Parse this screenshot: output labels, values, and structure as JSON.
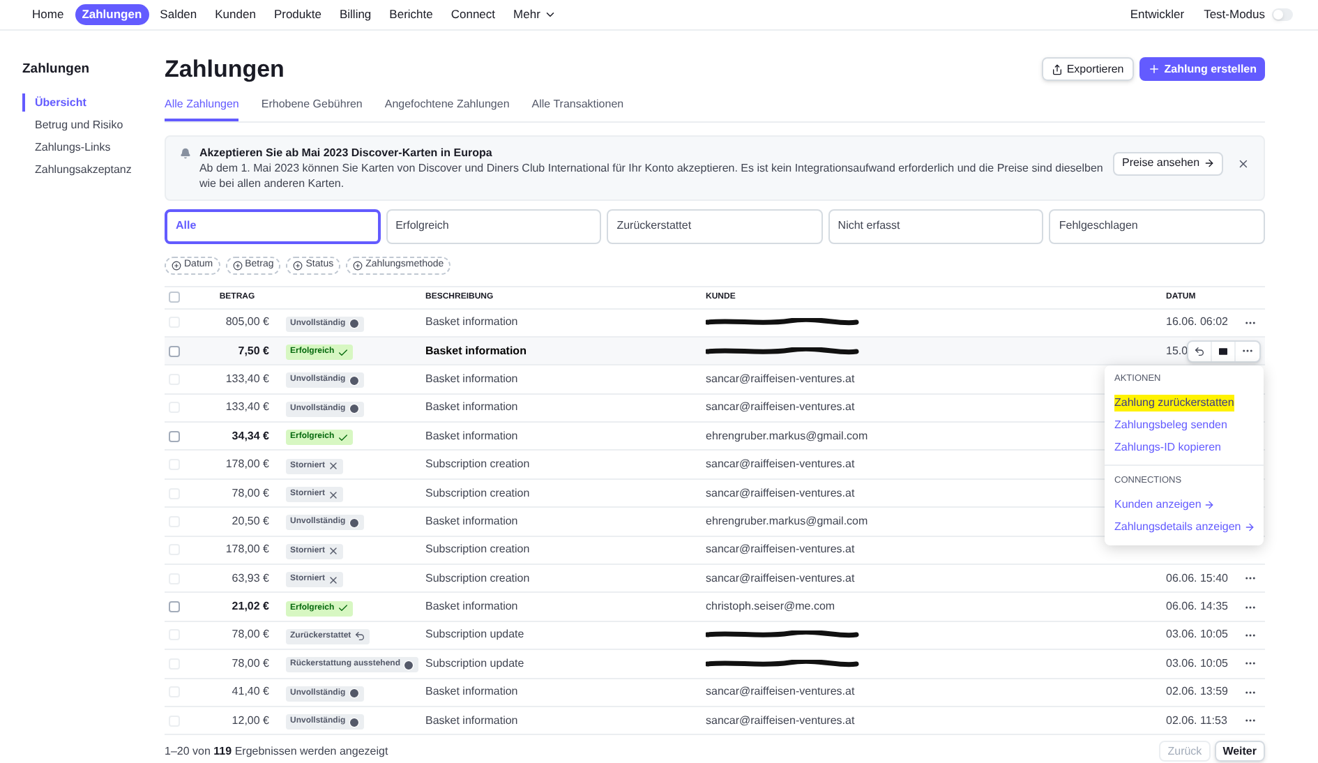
{
  "nav": {
    "items": [
      {
        "label": "Home",
        "selected": false
      },
      {
        "label": "Zahlungen",
        "selected": true
      },
      {
        "label": "Salden",
        "selected": false
      },
      {
        "label": "Kunden",
        "selected": false
      },
      {
        "label": "Produkte",
        "selected": false
      },
      {
        "label": "Billing",
        "selected": false
      },
      {
        "label": "Berichte",
        "selected": false
      },
      {
        "label": "Connect",
        "selected": false
      },
      {
        "label": "Mehr",
        "selected": false
      }
    ],
    "developer": "Entwickler",
    "test_mode": {
      "label": "Test-Modus",
      "on": false
    }
  },
  "sidebar": {
    "title": "Zahlungen",
    "items": [
      {
        "label": "Übersicht",
        "selected": true
      },
      {
        "label": "Betrug und Risiko",
        "selected": false
      },
      {
        "label": "Zahlungs-Links",
        "selected": false
      },
      {
        "label": "Zahlungsakzeptanz",
        "selected": false
      }
    ]
  },
  "page": {
    "title": "Zahlungen",
    "export": "Exportieren",
    "create": "Zahlung erstellen"
  },
  "tabs": [
    {
      "label": "Alle Zahlungen",
      "selected": true
    },
    {
      "label": "Erhobene Gebühren",
      "selected": false
    },
    {
      "label": "Angefochtene Zahlungen",
      "selected": false
    },
    {
      "label": "Alle Transaktionen",
      "selected": false
    }
  ],
  "banner": {
    "title": "Akzeptieren Sie ab Mai 2023 Discover-Karten in Europa",
    "text": "Ab dem 1. Mai 2023 können Sie Karten von Discover und Diners Club International für Ihr Konto akzeptieren. Es ist kein Integrationsaufwand erforderlich und die Preise sind dieselben wie bei allen anderen Karten.",
    "button": "Preise ansehen"
  },
  "status_filters": [
    {
      "label": "Alle",
      "selected": true
    },
    {
      "label": "Erfolgreich",
      "selected": false
    },
    {
      "label": "Zurückerstattet",
      "selected": false
    },
    {
      "label": "Nicht erfasst",
      "selected": false
    },
    {
      "label": "Fehlgeschlagen",
      "selected": false
    }
  ],
  "filter_chips": [
    "Datum",
    "Betrag",
    "Status",
    "Zahlungsmethode"
  ],
  "table": {
    "columns": [
      "BETRAG",
      "BESCHREIBUNG",
      "KUNDE",
      "DATUM"
    ],
    "all_checked": false,
    "rows": [
      {
        "amount": "805,00 €",
        "status": {
          "label": "Unvollständig",
          "kind": "incomplete"
        },
        "description": "Basket information",
        "customer": {
          "kind": "redacted"
        },
        "date": "16.06. 06:02",
        "hovered": false,
        "checked": false
      },
      {
        "amount": "7,50 €",
        "status": {
          "label": "Erfolgreich",
          "kind": "success"
        },
        "description": "Basket information",
        "customer": {
          "kind": "redacted"
        },
        "date": "15.0",
        "hovered": true,
        "checked": false
      },
      {
        "amount": "133,40 €",
        "status": {
          "label": "Unvollständig",
          "kind": "incomplete"
        },
        "description": "Basket information",
        "customer": {
          "kind": "email",
          "text": "sancar@raiffeisen-ventures.at"
        },
        "hovered": false,
        "checked": false
      },
      {
        "amount": "133,40 €",
        "status": {
          "label": "Unvollständig",
          "kind": "incomplete"
        },
        "description": "Basket information",
        "customer": {
          "kind": "email",
          "text": "sancar@raiffeisen-ventures.at"
        },
        "hovered": false,
        "checked": false
      },
      {
        "amount": "34,34 €",
        "status": {
          "label": "Erfolgreich",
          "kind": "success"
        },
        "description": "Basket information",
        "customer": {
          "kind": "email",
          "text": "ehrengruber.markus@gmail.com"
        },
        "hovered": false,
        "checked": false
      },
      {
        "amount": "178,00 €",
        "status": {
          "label": "Storniert",
          "kind": "canceled"
        },
        "description": "Subscription creation",
        "customer": {
          "kind": "email",
          "text": "sancar@raiffeisen-ventures.at"
        },
        "hovered": false,
        "checked": false
      },
      {
        "amount": "78,00 €",
        "status": {
          "label": "Storniert",
          "kind": "canceled"
        },
        "description": "Subscription creation",
        "customer": {
          "kind": "email",
          "text": "sancar@raiffeisen-ventures.at"
        },
        "hovered": false,
        "checked": false
      },
      {
        "amount": "20,50 €",
        "status": {
          "label": "Unvollständig",
          "kind": "incomplete"
        },
        "description": "Basket information",
        "customer": {
          "kind": "email",
          "text": "ehrengruber.markus@gmail.com"
        },
        "hovered": false,
        "checked": false
      },
      {
        "amount": "178,00 €",
        "status": {
          "label": "Storniert",
          "kind": "canceled"
        },
        "description": "Subscription creation",
        "customer": {
          "kind": "email",
          "text": "sancar@raiffeisen-ventures.at"
        },
        "hovered": false,
        "checked": false
      },
      {
        "amount": "63,93 €",
        "status": {
          "label": "Storniert",
          "kind": "canceled"
        },
        "description": "Subscription creation",
        "customer": {
          "kind": "email",
          "text": "sancar@raiffeisen-ventures.at"
        },
        "date": "06.06. 15:40",
        "hovered": false,
        "checked": false
      },
      {
        "amount": "21,02 €",
        "status": {
          "label": "Erfolgreich",
          "kind": "success"
        },
        "description": "Basket information",
        "customer": {
          "kind": "email",
          "text": "christoph.seiser@me.com"
        },
        "date": "06.06. 14:35",
        "hovered": false,
        "checked": false
      },
      {
        "amount": "78,00 €",
        "status": {
          "label": "Zurückerstattet",
          "kind": "refunded"
        },
        "description": "Subscription update",
        "customer": {
          "kind": "redacted"
        },
        "date": "03.06. 10:05",
        "hovered": false,
        "checked": false
      },
      {
        "amount": "78,00 €",
        "status": {
          "label": "Rückerstattung ausstehend",
          "kind": "pending"
        },
        "description": "Subscription update",
        "customer": {
          "kind": "redacted"
        },
        "date": "03.06. 10:05",
        "hovered": false,
        "checked": false
      },
      {
        "amount": "41,40 €",
        "status": {
          "label": "Unvollständig",
          "kind": "incomplete"
        },
        "description": "Basket information",
        "customer": {
          "kind": "email",
          "text": "sancar@raiffeisen-ventures.at"
        },
        "date": "02.06. 13:59",
        "hovered": false,
        "checked": false
      },
      {
        "amount": "12,00 €",
        "status": {
          "label": "Unvollständig",
          "kind": "incomplete"
        },
        "description": "Basket information",
        "customer": {
          "kind": "email",
          "text": "sancar@raiffeisen-ventures.at"
        },
        "date": "02.06. 11:53",
        "hovered": false,
        "checked": false
      }
    ]
  },
  "menu": {
    "sections": [
      {
        "title": "AKTIONEN",
        "items": [
          {
            "label": "Zahlung zurückerstatten",
            "highlighted": true,
            "arrow": false
          },
          {
            "label": "Zahlungsbeleg senden",
            "highlighted": false,
            "arrow": false
          },
          {
            "label": "Zahlungs-ID kopieren",
            "highlighted": false,
            "arrow": false
          }
        ]
      },
      {
        "title": "CONNECTIONS",
        "items": [
          {
            "label": "Kunden anzeigen",
            "highlighted": false,
            "arrow": true
          },
          {
            "label": "Zahlungsdetails anzeigen",
            "highlighted": false,
            "arrow": true
          }
        ]
      }
    ]
  },
  "footer": {
    "from": "1–20",
    "mid": "von",
    "total": "119",
    "rest": "Ergebnissen werden angezeigt",
    "prev": {
      "label": "Zurück",
      "disabled": true
    },
    "next": {
      "label": "Weiter",
      "disabled": false
    }
  }
}
